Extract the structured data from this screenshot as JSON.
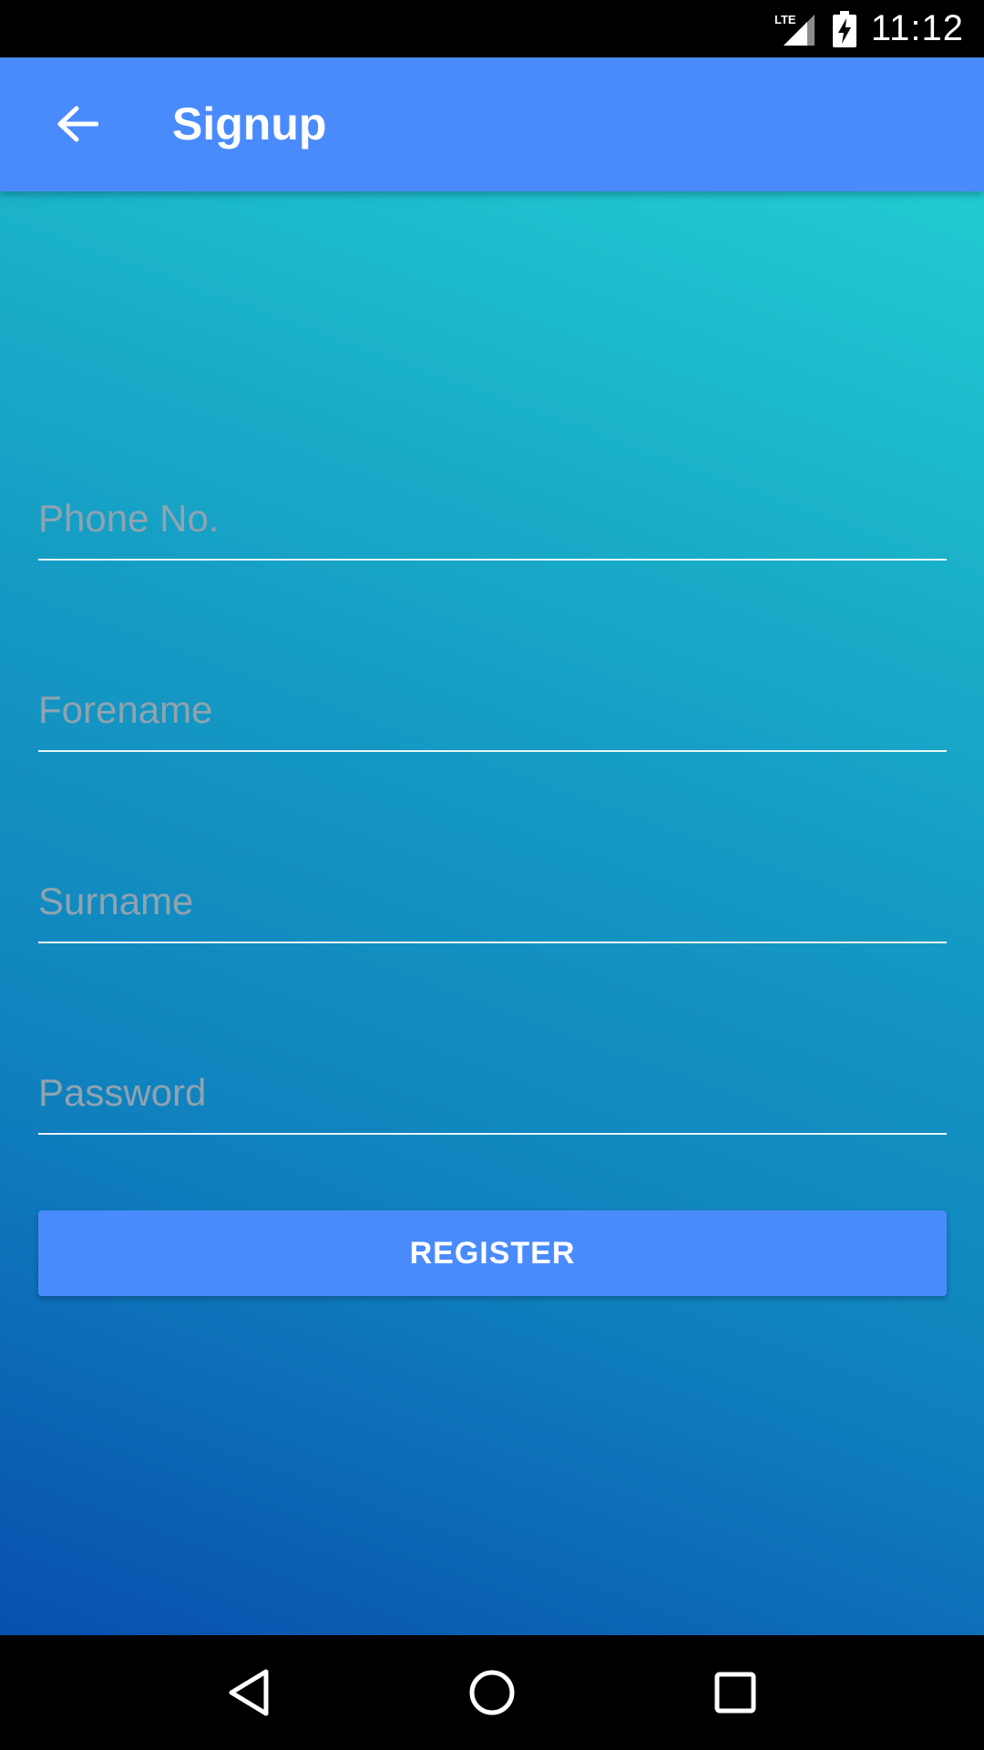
{
  "status_bar": {
    "network_label": "LTE",
    "time": "11:12"
  },
  "app_bar": {
    "title": "Signup",
    "back_icon": "arrow-back-icon"
  },
  "form": {
    "phone": {
      "placeholder": "Phone No.",
      "value": ""
    },
    "forename": {
      "placeholder": "Forename",
      "value": ""
    },
    "surname": {
      "placeholder": "Surname",
      "value": ""
    },
    "password": {
      "placeholder": "Password",
      "value": ""
    },
    "register_label": "REGISTER"
  },
  "nav_bar": {
    "back_icon": "nav-back-icon",
    "home_icon": "nav-home-icon",
    "recents_icon": "nav-recents-icon"
  },
  "colors": {
    "app_bar": "#4a8bfc",
    "button": "#4a8bfc",
    "gradient_top": "#21cbd1",
    "gradient_bottom": "#084fae"
  }
}
